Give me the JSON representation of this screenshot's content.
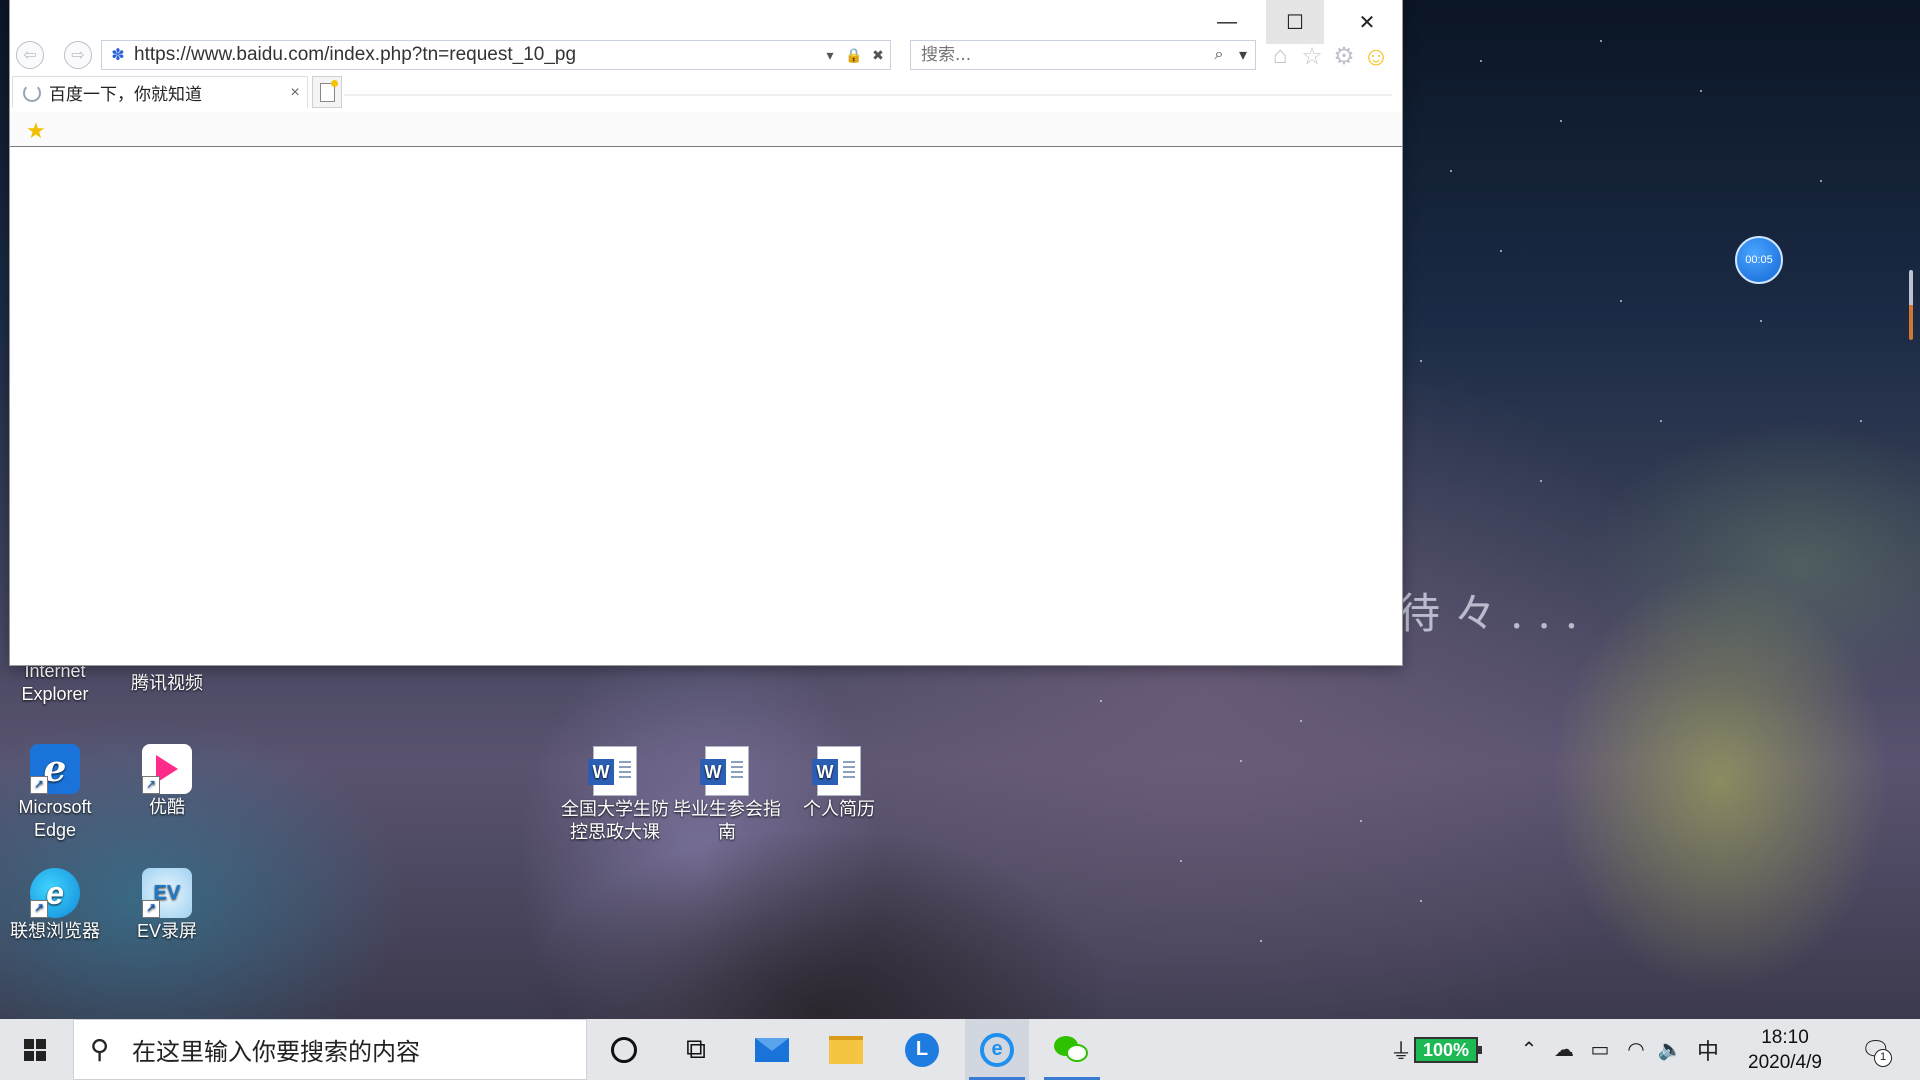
{
  "window": {
    "minimize_glyph": "—",
    "maximize_glyph": "☐",
    "close_glyph": "✕"
  },
  "browser": {
    "back_glyph": "⇦",
    "forward_glyph": "⇨",
    "url": "https://www.baidu.com/index.php?tn=request_10_pg",
    "search_placeholder": "搜索...",
    "tab_title": "百度一下，你就知道",
    "tab_close": "×",
    "toolbar_icons": [
      "home-icon",
      "favorites-icon",
      "tools-gear-icon",
      "feedback-smiley-icon"
    ]
  },
  "desktop": {
    "wallpaper_text": "待々...",
    "timer": "00:05",
    "icons": [
      {
        "label_line1": "Internet",
        "label_line2": "Explorer"
      },
      {
        "label_line1": "腾讯视频",
        "label_line2": ""
      },
      {
        "label_line1": "Microsoft",
        "label_line2": "Edge"
      },
      {
        "label_line1": "优酷",
        "label_line2": ""
      },
      {
        "label_line1": "联想浏览器",
        "label_line2": ""
      },
      {
        "label_line1": "EV录屏",
        "label_line2": ""
      },
      {
        "label_line1": "全国大学生防",
        "label_line2": "控思政大课"
      },
      {
        "label_line1": "毕业生参会指",
        "label_line2": "南"
      },
      {
        "label_line1": "个人简历",
        "label_line2": ""
      }
    ]
  },
  "taskbar": {
    "search_placeholder": "在这里输入你要搜索的内容",
    "battery_percent": "100%",
    "ime": "中",
    "time": "18:10",
    "date": "2020/4/9",
    "notification_count": "1"
  },
  "colors": {
    "accent": "#3a7bd5",
    "battery": "#1cb954",
    "taskbar_bg": "#e4e6ea"
  }
}
